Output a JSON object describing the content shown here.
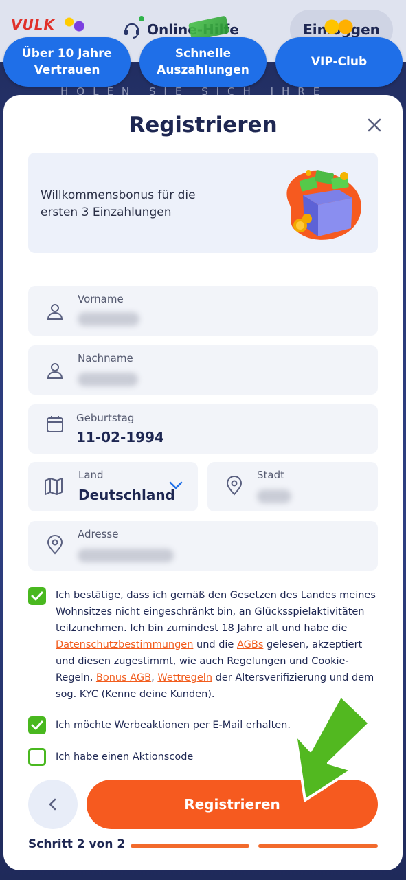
{
  "header": {
    "logo_text": "VULK",
    "help_label": "Online-Hilfe",
    "login_label": "Einloggen"
  },
  "promos": [
    {
      "label": "Über 10 Jahre\nVertrauen"
    },
    {
      "label": "Schnelle\nAuszahlungen"
    },
    {
      "label": "VIP-Club"
    }
  ],
  "tagline": "HOLEN SIE SICH IHRE",
  "modal": {
    "title": "Registrieren",
    "bonus_text": "Willkommensbonus für die ersten 3 Einzahlungen"
  },
  "form": {
    "first_name": {
      "label": "Vorname",
      "value": ""
    },
    "last_name": {
      "label": "Nachname",
      "value": ""
    },
    "birthday": {
      "label": "Geburtstag",
      "value": "11-02-1994"
    },
    "country": {
      "label": "Land",
      "value": "Deutschland"
    },
    "city": {
      "label": "Stadt",
      "value": ""
    },
    "address": {
      "label": "Adresse",
      "value": ""
    }
  },
  "consent": {
    "part1": "Ich bestätige, dass ich gemäß den Gesetzen des Landes meines Wohnsitzes nicht eingeschränkt bin, an Glücksspielaktivitäten teilzunehmen. Ich bin zumindest 18 Jahre alt und habe die ",
    "link_privacy": "Datenschutzbestimmungen",
    "part2": " und die ",
    "link_terms": "AGBs",
    "part3": " gelesen, akzeptiert und diesen zugestimmt, wie auch Regelungen und Cookie-Regeln, ",
    "link_bonus": "Bonus AGB",
    "part4": ", ",
    "link_betting": "Wettregeln",
    "part5": " der Altersverifizierung und dem sog. KYC (Kenne deine Kunden).",
    "checked": true
  },
  "newsletter": {
    "label": "Ich möchte Werbeaktionen per E-Mail erhalten.",
    "checked": true
  },
  "promo_code": {
    "label": "Ich habe einen Aktionscode",
    "checked": false
  },
  "footer": {
    "register_label": "Registrieren",
    "step_text": "Schritt 2 von 2"
  },
  "colors": {
    "accent": "#f65a1f",
    "brand_blue": "#1f6fe8",
    "check_green": "#49b81f",
    "text_dark": "#1e2752"
  }
}
